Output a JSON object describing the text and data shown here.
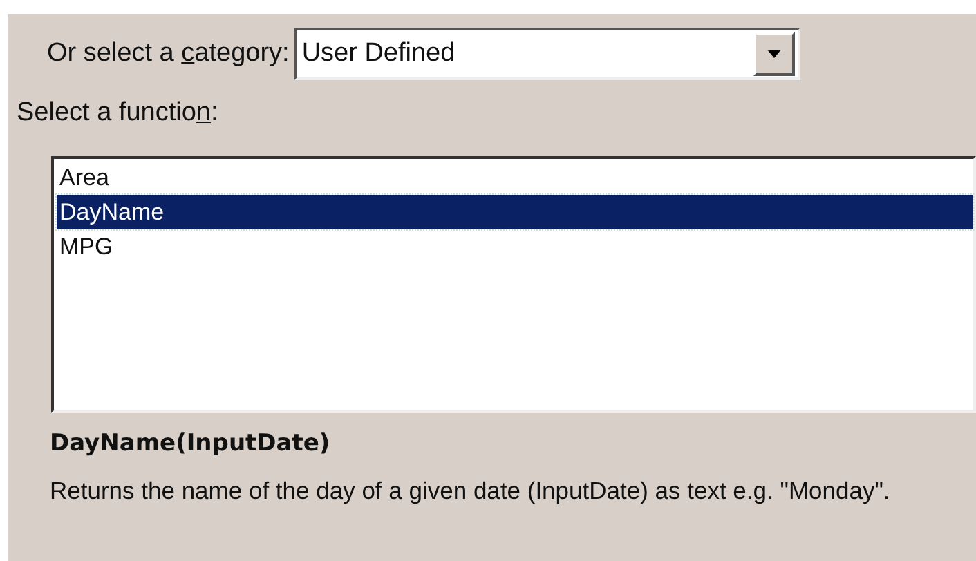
{
  "category": {
    "label": {
      "before": "Or select a ",
      "accelerator": "c",
      "after": "ategory:"
    },
    "value": "User Defined"
  },
  "function_list": {
    "label": {
      "before": "Select a functio",
      "accelerator": "n",
      "after": ":"
    },
    "items": [
      {
        "text": "Area",
        "selected": false
      },
      {
        "text": "DayName",
        "selected": true
      },
      {
        "text": "MPG",
        "selected": false
      }
    ]
  },
  "signature": "DayName(InputDate)",
  "description": "Returns the name of the day of a given date (InputDate) as text e.g. \"Monday\"."
}
